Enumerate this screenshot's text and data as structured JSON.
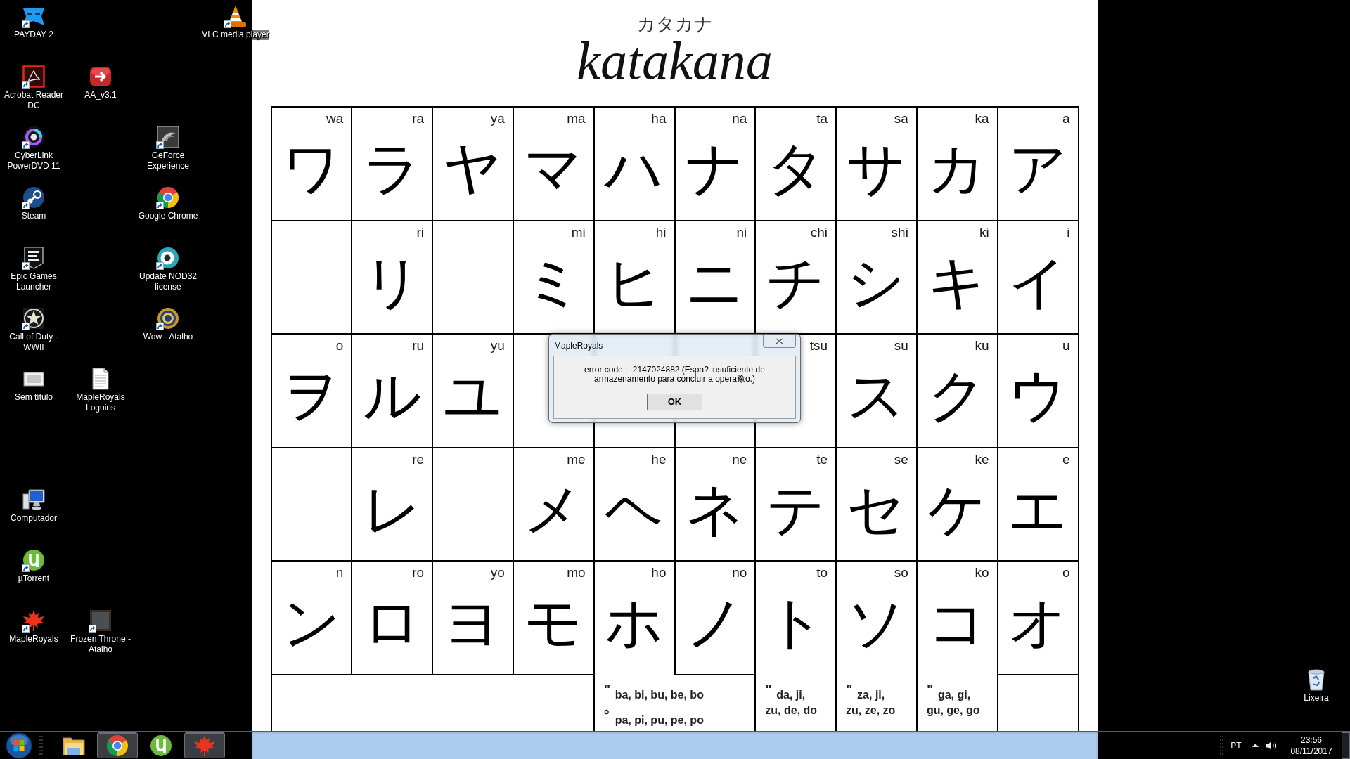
{
  "desktop_icons": [
    {
      "label": "PAYDAY 2",
      "kind": "mask",
      "shortcut": true
    },
    {
      "label": "VLC media player",
      "kind": "cone",
      "shortcut": true
    },
    {
      "label": "Acrobat Reader DC",
      "kind": "pdf",
      "shortcut": true
    },
    {
      "label": "AA_v3.1",
      "kind": "arrow",
      "shortcut": false
    },
    {
      "label": "CyberLink PowerDVD 11",
      "kind": "ring",
      "shortcut": true
    },
    {
      "label": "GeForce Experience",
      "kind": "tile",
      "shortcut": true
    },
    {
      "label": "Steam",
      "kind": "piston",
      "shortcut": true
    },
    {
      "label": "Google Chrome",
      "kind": "browser",
      "shortcut": true
    },
    {
      "label": "Epic Games Launcher",
      "kind": "shield",
      "shortcut": true
    },
    {
      "label": "Update NOD32 license",
      "kind": "eye",
      "shortcut": true
    },
    {
      "label": "Call of Duty - WWII",
      "kind": "star",
      "shortcut": true
    },
    {
      "label": "Wow - Atalho",
      "kind": "emblem",
      "shortcut": true
    },
    {
      "label": "Sem título",
      "kind": "image",
      "shortcut": false
    },
    {
      "label": "MapleRoyals Loguins",
      "kind": "text",
      "shortcut": false
    },
    {
      "label": "Computador",
      "kind": "computer",
      "shortcut": false
    },
    {
      "label": "µTorrent",
      "kind": "disc",
      "shortcut": true
    },
    {
      "label": "MapleRoyals",
      "kind": "leaf",
      "shortcut": true
    },
    {
      "label": "Frozen Throne - Atalho",
      "kind": "picture",
      "shortcut": true
    },
    {
      "label": "Lixeira",
      "kind": "bin",
      "shortcut": false
    }
  ],
  "wallpaper": {
    "subtitle": "カタカナ",
    "title": "katakana",
    "rows": [
      [
        {
          "romaji": "wa",
          "kana": "ワ"
        },
        {
          "romaji": "ra",
          "kana": "ラ"
        },
        {
          "romaji": "ya",
          "kana": "ヤ"
        },
        {
          "romaji": "ma",
          "kana": "マ"
        },
        {
          "romaji": "ha",
          "kana": "ハ"
        },
        {
          "romaji": "na",
          "kana": "ナ"
        },
        {
          "romaji": "ta",
          "kana": "タ"
        },
        {
          "romaji": "sa",
          "kana": "サ"
        },
        {
          "romaji": "ka",
          "kana": "カ"
        },
        {
          "romaji": "a",
          "kana": "ア"
        }
      ],
      [
        {},
        {
          "romaji": "ri",
          "kana": "リ"
        },
        {},
        {
          "romaji": "mi",
          "kana": "ミ"
        },
        {
          "romaji": "hi",
          "kana": "ヒ"
        },
        {
          "romaji": "ni",
          "kana": "ニ"
        },
        {
          "romaji": "chi",
          "kana": "チ"
        },
        {
          "romaji": "shi",
          "kana": "シ"
        },
        {
          "romaji": "ki",
          "kana": "キ"
        },
        {
          "romaji": "i",
          "kana": "イ"
        }
      ],
      [
        {
          "romaji": "o",
          "kana": "ヲ"
        },
        {
          "romaji": "ru",
          "kana": "ル"
        },
        {
          "romaji": "yu",
          "kana": "ユ"
        },
        {},
        {},
        {},
        {
          "romaji": "tsu"
        },
        {
          "romaji": "su",
          "kana": "ス"
        },
        {
          "romaji": "ku",
          "kana": "ク"
        },
        {
          "romaji": "u",
          "kana": "ウ"
        }
      ],
      [
        {},
        {
          "romaji": "re",
          "kana": "レ"
        },
        {},
        {
          "romaji": "me",
          "kana": "メ"
        },
        {
          "romaji": "he",
          "kana": "ヘ"
        },
        {
          "romaji": "ne",
          "kana": "ネ"
        },
        {
          "romaji": "te",
          "kana": "テ"
        },
        {
          "romaji": "se",
          "kana": "セ"
        },
        {
          "romaji": "ke",
          "kana": "ケ"
        },
        {
          "romaji": "e",
          "kana": "エ"
        }
      ],
      [
        {
          "romaji": "n",
          "kana": "ン"
        },
        {
          "romaji": "ro",
          "kana": "ロ"
        },
        {
          "romaji": "yo",
          "kana": "ヨ"
        },
        {
          "romaji": "mo",
          "kana": "モ"
        },
        {
          "romaji": "ho",
          "kana": "ホ"
        },
        {
          "romaji": "no",
          "kana": "ノ"
        },
        {
          "romaji": "to",
          "kana": "ト"
        },
        {
          "romaji": "so",
          "kana": "ソ"
        },
        {
          "romaji": "ko",
          "kana": "コ"
        },
        {
          "romaji": "o",
          "kana": "オ"
        }
      ]
    ],
    "notes": [
      {
        "lines": [
          {
            "mark": "\"",
            "text": "ba, bi, bu, be, bo"
          },
          {
            "mark": "°",
            "text": "pa, pi, pu, pe, po"
          }
        ]
      },
      {
        "lines": [
          {
            "mark": "\"",
            "text": "da, ji,"
          },
          {
            "text": "zu, de, do"
          }
        ]
      },
      {
        "lines": [
          {
            "mark": "\"",
            "text": "za, ji,"
          },
          {
            "text": "zu, ze, zo"
          }
        ]
      },
      {
        "lines": [
          {
            "mark": "\"",
            "text": "ga, gi,"
          },
          {
            "text": "gu, ge, go"
          }
        ]
      }
    ]
  },
  "dialog": {
    "title": "MapleRoyals",
    "message": "error code : -2147024882 (Espa? insuficiente de armazenamento para concluir a opera豫o.)",
    "buttons": [
      "OK"
    ]
  },
  "taskbar": {
    "items": [
      {
        "kind": "folder",
        "running": false
      },
      {
        "kind": "browser",
        "running": true
      },
      {
        "kind": "disc",
        "running": false
      },
      {
        "kind": "leaf",
        "running": true
      }
    ],
    "language": "PT",
    "time": "23:56",
    "date": "08/11/2017"
  }
}
